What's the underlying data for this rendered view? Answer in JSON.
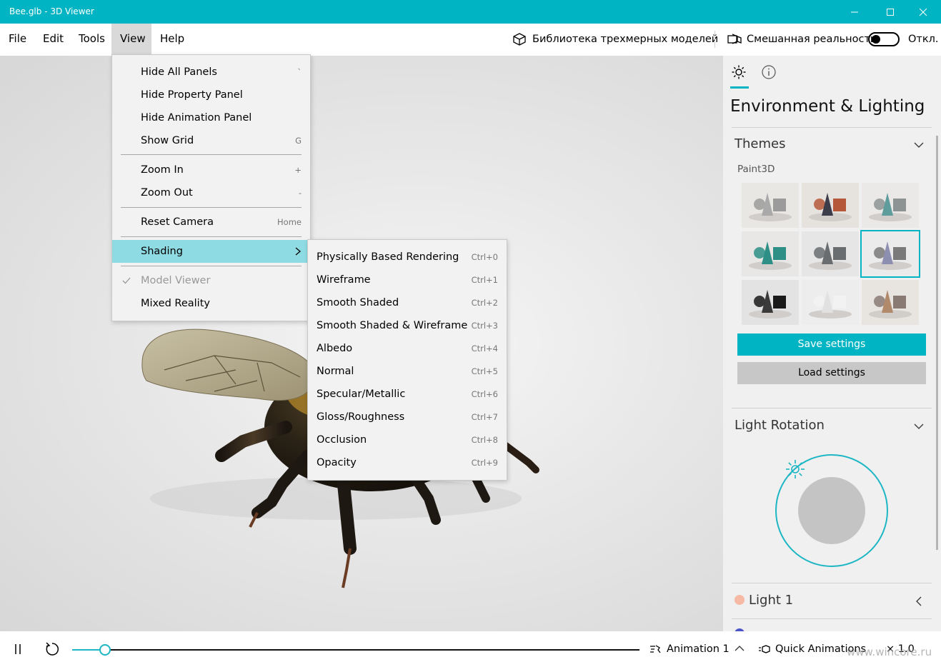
{
  "window": {
    "title": "Bee.glb - 3D Viewer"
  },
  "menubar": {
    "items": [
      "File",
      "Edit",
      "Tools",
      "View",
      "Help"
    ],
    "library_label": "Библиотека трехмерных моделей",
    "mixed_reality_label": "Смешанная реальность",
    "toggle_state": "Откл."
  },
  "view_menu": {
    "items": [
      {
        "label": "Hide All Panels",
        "shortcut": "`"
      },
      {
        "label": "Hide Property Panel",
        "shortcut": ""
      },
      {
        "label": "Hide Animation Panel",
        "shortcut": ""
      },
      {
        "label": "Show Grid",
        "shortcut": "G"
      },
      {
        "label": "Zoom In",
        "shortcut": "+"
      },
      {
        "label": "Zoom Out",
        "shortcut": "-"
      },
      {
        "label": "Reset Camera",
        "shortcut": "Home"
      },
      {
        "label": "Shading",
        "shortcut": ""
      },
      {
        "label": "Model Viewer",
        "shortcut": ""
      },
      {
        "label": "Mixed Reality",
        "shortcut": ""
      }
    ]
  },
  "shading_menu": {
    "items": [
      {
        "label": "Physically Based Rendering",
        "shortcut": "Ctrl+0"
      },
      {
        "label": "Wireframe",
        "shortcut": "Ctrl+1"
      },
      {
        "label": "Smooth Shaded",
        "shortcut": "Ctrl+2"
      },
      {
        "label": "Smooth Shaded & Wireframe",
        "shortcut": "Ctrl+3"
      },
      {
        "label": "Albedo",
        "shortcut": "Ctrl+4"
      },
      {
        "label": "Normal",
        "shortcut": "Ctrl+5"
      },
      {
        "label": "Specular/Metallic",
        "shortcut": "Ctrl+6"
      },
      {
        "label": "Gloss/Roughness",
        "shortcut": "Ctrl+7"
      },
      {
        "label": "Occlusion",
        "shortcut": "Ctrl+8"
      },
      {
        "label": "Opacity",
        "shortcut": "Ctrl+9"
      }
    ]
  },
  "panel": {
    "heading": "Environment & Lighting",
    "themes_label": "Themes",
    "theme_group": "Paint3D",
    "save_label": "Save settings",
    "load_label": "Load settings",
    "light_rotation_label": "Light Rotation",
    "light1_label": "Light 1"
  },
  "bottombar": {
    "animation_label": "Animation 1",
    "quick_animations_label": "Quick Animations",
    "speed_label": "× 1.0",
    "watermark": "www.wincore.ru"
  },
  "colors": {
    "accent": "#00b4c4",
    "menu_highlight": "#8fdbe3"
  }
}
